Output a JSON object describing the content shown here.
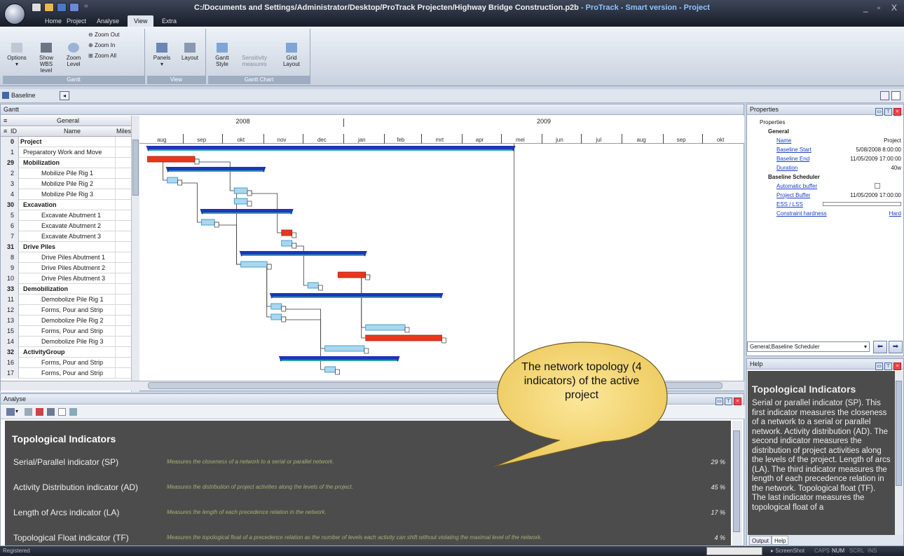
{
  "window": {
    "title_path": "C:/Documents and Settings/Administrator/Desktop/ProTrack Projecten/Highway Bridge Construction.p2b",
    "title_suffix": " - ProTrack - Smart version - Project",
    "controls": [
      "_",
      "▫",
      "X"
    ]
  },
  "tabs": [
    "Home",
    "Project",
    "Analyse",
    "View",
    "Extra"
  ],
  "active_tab": "View",
  "ribbon": {
    "gantt": {
      "caption": "Gantt",
      "options": "Options",
      "show_wbs": "Show WBS\nlevel",
      "zoom_level": "Zoom\nLevel",
      "zoom_out": "Zoom Out",
      "zoom_in": "Zoom In",
      "zoom_all": "Zoom All"
    },
    "view": {
      "caption": "View",
      "panels": "Panels",
      "layout": "Layout"
    },
    "gantt_chart": {
      "caption": "Gantt Chart",
      "gantt_style": "Gantt\nStyle",
      "sensitivity": "Sensitivity\nmeasures",
      "grid_layout": "Grid\nLayout"
    }
  },
  "baseline_bar": {
    "label": "Baseline"
  },
  "gantt": {
    "panel_title": "Gantt",
    "group_header": "General",
    "col_id": "ID",
    "col_name": "Name",
    "col_miles": "Miles",
    "rows": [
      {
        "id": "0",
        "name": "Project",
        "bold": true,
        "indent": 0
      },
      {
        "id": "1",
        "name": "Preparatory Work and Move",
        "bold": false,
        "indent": 1
      },
      {
        "id": "29",
        "name": "Mobilization",
        "bold": true,
        "indent": 1
      },
      {
        "id": "2",
        "name": "Mobilize Pile Rig 1",
        "bold": false,
        "indent": 2
      },
      {
        "id": "3",
        "name": "Mobilize Pile Rig 2",
        "bold": false,
        "indent": 2
      },
      {
        "id": "4",
        "name": "Mobilize Pile Rig 3",
        "bold": false,
        "indent": 2
      },
      {
        "id": "30",
        "name": "Excavation",
        "bold": true,
        "indent": 1
      },
      {
        "id": "5",
        "name": "Excavate Abutment 1",
        "bold": false,
        "indent": 2
      },
      {
        "id": "6",
        "name": "Excavate Abutment 2",
        "bold": false,
        "indent": 2
      },
      {
        "id": "7",
        "name": "Excavate Abutment 3",
        "bold": false,
        "indent": 2
      },
      {
        "id": "31",
        "name": "Drive Piles",
        "bold": true,
        "indent": 1
      },
      {
        "id": "8",
        "name": "Drive Piles Abutment 1",
        "bold": false,
        "indent": 2
      },
      {
        "id": "9",
        "name": "Drive Piles Abutment 2",
        "bold": false,
        "indent": 2
      },
      {
        "id": "10",
        "name": "Drive Piles Abutment 3",
        "bold": false,
        "indent": 2
      },
      {
        "id": "33",
        "name": "Demobilization",
        "bold": true,
        "indent": 1
      },
      {
        "id": "11",
        "name": "Demobolize Pile Rig 1",
        "bold": false,
        "indent": 2
      },
      {
        "id": "12",
        "name": "Forms, Pour and Strip",
        "bold": false,
        "indent": 2
      },
      {
        "id": "13",
        "name": "Demobolize Pile Rig 2",
        "bold": false,
        "indent": 2
      },
      {
        "id": "15",
        "name": "Forms, Pour and Strip",
        "bold": false,
        "indent": 2
      },
      {
        "id": "14",
        "name": "Demobolize Pile Rig 3",
        "bold": false,
        "indent": 2
      },
      {
        "id": "32",
        "name": "ActivityGroup",
        "bold": true,
        "indent": 1
      },
      {
        "id": "16",
        "name": "Forms, Pour and Strip",
        "bold": false,
        "indent": 2
      },
      {
        "id": "17",
        "name": "Forms, Pour and Strip",
        "bold": false,
        "indent": 2
      }
    ],
    "years": [
      "2008",
      "2009"
    ],
    "months": [
      "aug",
      "sep",
      "okt",
      "nov",
      "dec",
      "jan",
      "feb",
      "mrt",
      "apr",
      "mei",
      "jun",
      "jul",
      "aug",
      "sep",
      "okt"
    ],
    "timeline_start": "2008-08-01",
    "timeline_end": "2009-10-31",
    "bars": [
      {
        "row": 0,
        "type": "summary",
        "start": "2008-08-05",
        "end": "2009-05-11"
      },
      {
        "row": 1,
        "type": "critical",
        "start": "2008-08-05",
        "end": "2008-09-10"
      },
      {
        "row": 2,
        "type": "summary",
        "start": "2008-08-20",
        "end": "2008-11-02"
      },
      {
        "row": 3,
        "type": "normal",
        "start": "2008-08-20",
        "end": "2008-08-28"
      },
      {
        "row": 4,
        "type": "normal",
        "start": "2008-10-10",
        "end": "2008-10-20"
      },
      {
        "row": 5,
        "type": "normal",
        "start": "2008-10-10",
        "end": "2008-10-20"
      },
      {
        "row": 6,
        "type": "summary",
        "start": "2008-09-15",
        "end": "2008-11-23"
      },
      {
        "row": 7,
        "type": "normal",
        "start": "2008-09-15",
        "end": "2008-09-25"
      },
      {
        "row": 8,
        "type": "critical",
        "start": "2008-11-15",
        "end": "2008-11-23"
      },
      {
        "row": 9,
        "type": "normal",
        "start": "2008-11-15",
        "end": "2008-11-23"
      },
      {
        "row": 10,
        "type": "summary",
        "start": "2008-10-15",
        "end": "2009-01-18"
      },
      {
        "row": 11,
        "type": "normal",
        "start": "2008-10-15",
        "end": "2008-11-04"
      },
      {
        "row": 12,
        "type": "critical",
        "start": "2008-12-28",
        "end": "2009-01-18"
      },
      {
        "row": 13,
        "type": "normal",
        "start": "2008-12-05",
        "end": "2008-12-13"
      },
      {
        "row": 14,
        "type": "summary",
        "start": "2008-11-07",
        "end": "2009-03-17"
      },
      {
        "row": 15,
        "type": "normal",
        "start": "2008-11-07",
        "end": "2008-11-15"
      },
      {
        "row": 16,
        "type": "normal",
        "start": "2008-11-07",
        "end": "2008-11-15"
      },
      {
        "row": 17,
        "type": "normal",
        "start": "2009-01-18",
        "end": "2009-02-17"
      },
      {
        "row": 18,
        "type": "critical",
        "start": "2009-01-18",
        "end": "2009-03-17"
      },
      {
        "row": 19,
        "type": "normal",
        "start": "2008-12-18",
        "end": "2009-01-17"
      },
      {
        "row": 20,
        "type": "summary",
        "start": "2008-11-14",
        "end": "2009-02-12"
      },
      {
        "row": 21,
        "type": "normal",
        "start": "2008-12-18",
        "end": "2008-12-26"
      }
    ],
    "colors": {
      "summary": "#1f35b8",
      "summary_edge": "#2aa3a8",
      "critical": "#e8371c",
      "normal": "#a8d8ef",
      "normal_edge": "#2c8fc4"
    }
  },
  "properties": {
    "panel_title": "Properties",
    "root": "Properties",
    "general_header": "General",
    "general": [
      {
        "label": "Name",
        "value": "Project"
      },
      {
        "label": "Baseline Start",
        "value": "5/08/2008 8:00:00"
      },
      {
        "label": "Baseline End",
        "value": "11/05/2009 17:00:00"
      },
      {
        "label": "Duration",
        "value": "40w"
      }
    ],
    "scheduler_header": "Baseline Scheduler",
    "scheduler": [
      {
        "label": "Automatic buffer",
        "value": ""
      },
      {
        "label": "Project Buffer",
        "value": "11/05/2009 17:00:00"
      },
      {
        "label": "ESS / LSS",
        "value": ""
      },
      {
        "label": "Constraint hardness",
        "value": "Hard"
      }
    ],
    "selector": "General;Baseline Scheduler"
  },
  "help": {
    "panel_title": "Help",
    "title": "Topological Indicators",
    "text": "Serial or parallel indicator (SP). This first indicator measures the closeness of a network to a serial or parallel network. Activity distribution (AD). The second indicator measures the distribution of project activities along the levels of the project. Length of arcs (LA). The third indicator measures the length of each precedence relation in the network. Topological float (TF). The last indicator measures the topological float of a",
    "tabs": [
      "Output",
      "Help"
    ]
  },
  "analyse": {
    "panel_title": "Analyse",
    "title": "Topological Indicators",
    "indicators": [
      {
        "name": "Serial/Parallel indicator (SP)",
        "desc": "Measures the closeness of a network to a serial or parallel network.",
        "value": "29 %"
      },
      {
        "name": "Activity Distribution indicator (AD)",
        "desc": "Measures the distribution of project activities along the levels of the project.",
        "value": "45 %"
      },
      {
        "name": "Length of Arcs indicator (LA)",
        "desc": "Measures the length of each precedence relation in the network.",
        "value": "17 %"
      },
      {
        "name": "Topological Float indicator (TF)",
        "desc": "Measures the topological float of a precedence relation as the number of levels each activity can shift without violating the maximal level of the network.",
        "value": "4 %"
      }
    ]
  },
  "callout": {
    "text": "The network topology (4 indicators) of the active project"
  },
  "status": {
    "left": "Registered",
    "screenshot": "ScreenShot",
    "keys": [
      "CAPS",
      "NUM",
      "SCRL",
      "INS"
    ]
  }
}
